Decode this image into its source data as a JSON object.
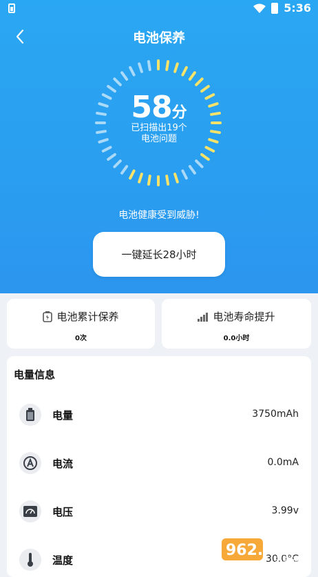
{
  "status_bar": {
    "time": "5:36"
  },
  "header": {
    "title": "电池保养",
    "score": "58",
    "score_unit": "分",
    "scan_line1": "已扫描出19个",
    "scan_line2": "电池问题",
    "warning": "电池健康受到威胁!",
    "extend_button": "一键延长28小时"
  },
  "stats": [
    {
      "label": "电池累计保养",
      "value": "0次",
      "icon": "battery-care-icon"
    },
    {
      "label": "电池寿命提升",
      "value": "0.0小时",
      "icon": "signal-bars-icon"
    }
  ],
  "info": {
    "title": "电量信息",
    "rows": [
      {
        "label": "电量",
        "value": "3750mAh",
        "icon": "battery-icon"
      },
      {
        "label": "电流",
        "value": "0.0mA",
        "icon": "current-icon"
      },
      {
        "label": "电压",
        "value": "3.99v",
        "icon": "voltmeter-icon"
      },
      {
        "label": "温度",
        "value": "30.0°C",
        "icon": "thermometer-icon"
      }
    ]
  },
  "watermark": {
    "text1": "962.NET",
    "text2": "乐游网"
  },
  "colors": {
    "header_blue": "#2aa7f2",
    "dial_yellow": "#f7e36a",
    "dial_white": "#ffffff"
  }
}
